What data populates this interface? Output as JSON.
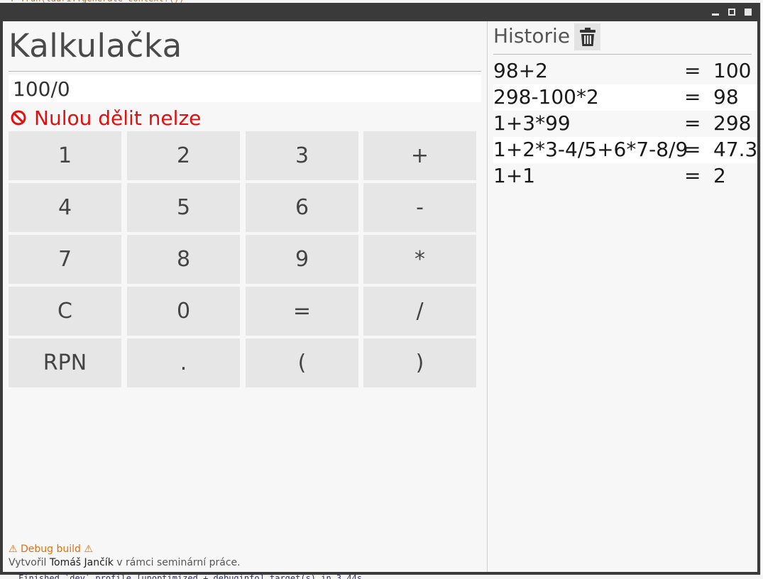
{
  "window": {
    "title": "Kalkulačka"
  },
  "calculator": {
    "title": "Kalkulačka",
    "input_value": "100/0",
    "error_message": "Nulou dělit nelze",
    "keys": [
      [
        "1",
        "2",
        "3",
        "+"
      ],
      [
        "4",
        "5",
        "6",
        "-"
      ],
      [
        "7",
        "8",
        "9",
        "*"
      ],
      [
        "C",
        "0",
        "=",
        "/"
      ],
      [
        "RPN",
        ".",
        "(",
        ")"
      ]
    ]
  },
  "footer": {
    "debug": "⚠ Debug build ⚠",
    "credit_prefix": "Vytvořil",
    "credit_author": "Tomáš Jančík",
    "credit_suffix": "v rámci seminární práce."
  },
  "history": {
    "title": "Historie",
    "items": [
      {
        "expression": "98+2",
        "equals": "=",
        "result": "100"
      },
      {
        "expression": "298-100*2",
        "equals": "=",
        "result": "98"
      },
      {
        "expression": "1+3*99",
        "equals": "=",
        "result": "298"
      },
      {
        "expression": "1+2*3-4/5+6*7-8/9",
        "equals": "=",
        "result": "47.3"
      },
      {
        "expression": "1+1",
        "equals": "=",
        "result": "2"
      }
    ]
  },
  "colors": {
    "error": "#e01010",
    "debug": "#e5700b",
    "key_bg": "#e6e6e6",
    "titlebar": "#3a3a3a"
  },
  "icons": {
    "error": "prohibited-icon",
    "clear_history": "trash-icon",
    "window_controls": [
      "minimize-icon",
      "maximize-icon",
      "close-icon"
    ]
  }
}
